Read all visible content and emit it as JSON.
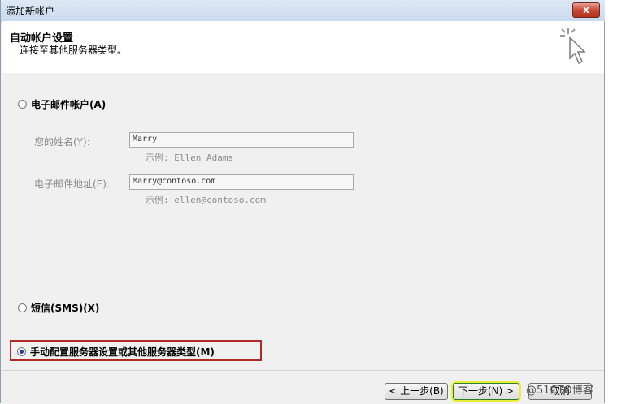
{
  "window": {
    "title": "添加新帐户",
    "close_label": "x"
  },
  "header": {
    "title": "自动帐户设置",
    "subtitle": "连接至其他服务器类型。",
    "icon": "cursor-sparkle-icon"
  },
  "options": {
    "email_account": {
      "label": "电子邮件帐户(A)",
      "selected": false
    },
    "sms": {
      "label": "短信(SMS)(X)",
      "selected": false
    },
    "manual": {
      "label": "手动配置服务器设置或其他服务器类型(M)",
      "selected": true
    }
  },
  "form": {
    "name_label": "您的姓名(Y):",
    "name_value": "Marry",
    "name_example": "示例: Ellen Adams",
    "email_label": "电子邮件地址(E):",
    "email_value": "Marry@contoso.com",
    "email_example": "示例: ellen@contoso.com"
  },
  "footer": {
    "back_label": "< 上一步(B)",
    "next_label": "下一步(N) >",
    "cancel_label": "取消"
  },
  "watermark": "@51CTO博客",
  "colors": {
    "highlight_border": "#b02a2a",
    "next_highlight": "#e8ef3a"
  }
}
